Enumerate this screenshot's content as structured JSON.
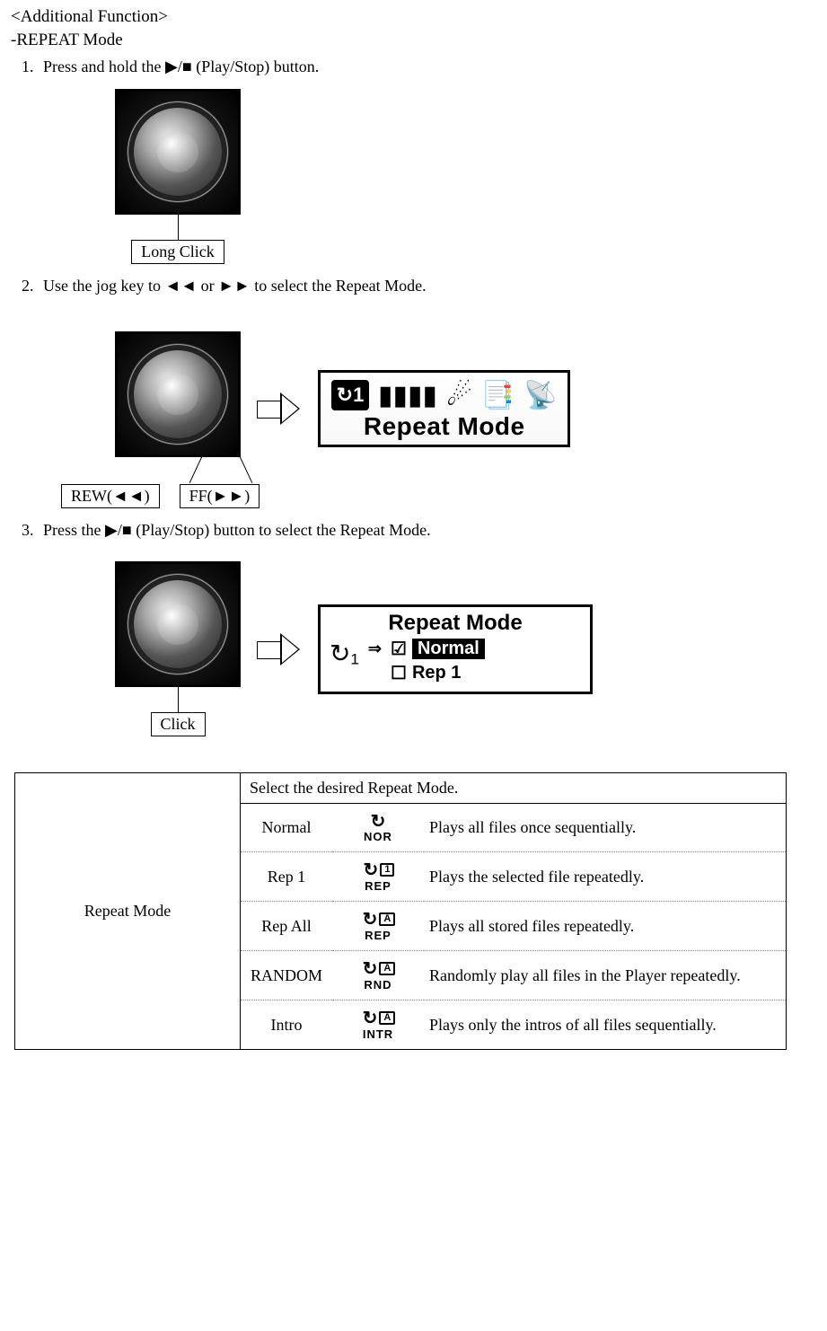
{
  "headings": {
    "additional_function": "<Additional Function>",
    "repeat_mode": "-REPEAT Mode"
  },
  "steps": {
    "s1": "Press and hold the ▶/■ (Play/Stop) button.",
    "s2": "Use the jog key to ◄◄ or ►► to select the Repeat Mode.",
    "s3": "Press the ▶/■ (Play/Stop) button to select the Repeat Mode."
  },
  "callouts": {
    "long_click": "Long Click",
    "rew": "REW(◄◄)",
    "ff": "FF(►►)",
    "click": "Click"
  },
  "lcd1": {
    "label": "Repeat Mode"
  },
  "lcd2": {
    "title": "Repeat Mode",
    "opt_selected": "Normal",
    "opt_other": "Rep 1"
  },
  "table": {
    "rowhead": "Repeat Mode",
    "header": "Select the desired Repeat Mode.",
    "modes": [
      {
        "name": "Normal",
        "tag": "NOR",
        "corner": "",
        "desc": "Plays all files once sequentially."
      },
      {
        "name": "Rep 1",
        "tag": "REP",
        "corner": "1",
        "desc": "Plays the selected file repeatedly."
      },
      {
        "name": "Rep All",
        "tag": "REP",
        "corner": "A",
        "desc": "Plays all stored files repeatedly."
      },
      {
        "name": "RANDOM",
        "tag": "RND",
        "corner": "A",
        "desc": "Randomly play all files in the Player repeatedly."
      },
      {
        "name": "Intro",
        "tag": "INTR",
        "corner": "A",
        "desc": "Plays only the intros of all files sequentially."
      }
    ]
  }
}
